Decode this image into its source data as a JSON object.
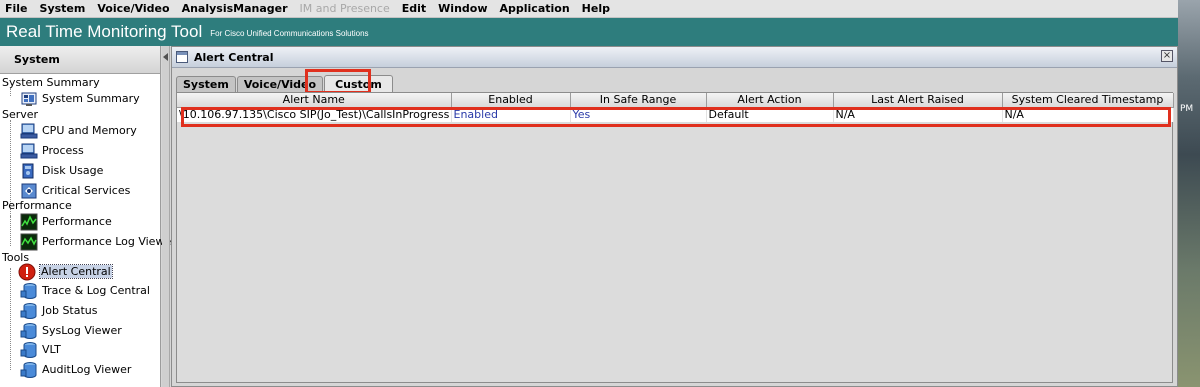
{
  "menu": [
    {
      "label": "File",
      "enabled": true
    },
    {
      "label": "System",
      "enabled": true
    },
    {
      "label": "Voice/Video",
      "enabled": true
    },
    {
      "label": "AnalysisManager",
      "enabled": true
    },
    {
      "label": "IM and Presence",
      "enabled": false
    },
    {
      "label": "Edit",
      "enabled": true
    },
    {
      "label": "Window",
      "enabled": true
    },
    {
      "label": "Application",
      "enabled": true
    },
    {
      "label": "Help",
      "enabled": true
    }
  ],
  "banner": {
    "title": "Real Time Monitoring Tool",
    "subtitle": "For Cisco Unified Communications Solutions",
    "color": "#2e7d7d"
  },
  "sidebar": {
    "header": "System",
    "categories": {
      "system_summary": "System Summary",
      "server": "Server",
      "performance": "Performance",
      "tools": "Tools"
    },
    "items": {
      "system_summary": "System Summary",
      "cpu_memory": "CPU and Memory",
      "process": "Process",
      "disk_usage": "Disk Usage",
      "critical_services": "Critical Services",
      "performance": "Performance",
      "perf_log_viewer": "Performance Log Viewer",
      "alert_central": "Alert Central",
      "trace_log_central": "Trace & Log Central",
      "job_status": "Job Status",
      "syslog_viewer": "SysLog Viewer",
      "vlt": "VLT",
      "auditlog_viewer": "AuditLog Viewer"
    },
    "selected": "alert_central"
  },
  "frame": {
    "title": "Alert Central",
    "tabs": {
      "system": "System",
      "voice_video": "Voice/Video",
      "custom": "Custom"
    },
    "active_tab": "custom"
  },
  "table": {
    "headers": {
      "alert_name": "Alert Name",
      "enabled": "Enabled",
      "in_safe_range": "In Safe Range",
      "alert_action": "Alert Action",
      "last_alert_raised": "Last Alert Raised",
      "system_cleared": "System Cleared Timestamp"
    },
    "rows": [
      {
        "alert_name": "\\10.106.97.135\\Cisco SIP(Jo_Test)\\CallsInProgress",
        "enabled": "Enabled",
        "in_safe_range": "Yes",
        "alert_action": "Default",
        "last_alert_raised": "N/A",
        "system_cleared": "N/A"
      }
    ]
  },
  "highlight_color": "#e0301e",
  "desktop_edge": {
    "pm_label": "PM"
  }
}
